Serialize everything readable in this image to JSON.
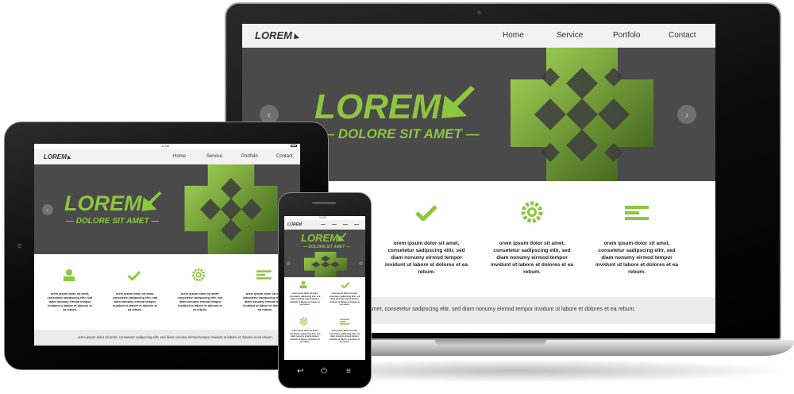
{
  "site": {
    "logo": "LOREM",
    "nav": [
      "Home",
      "Service",
      "Portfolo",
      "Contact"
    ],
    "hero_title": "LOREM",
    "hero_subtitle": "— DOLORE SIT AMET —",
    "feature_text": "orem ipsum dolor sit amet, consetetur sadipscing elitr, sed diam nonumy eirmod tempor invidunt ut labore et dolores et ea rebum.",
    "footer_text": "orem ipsum dolor sit amet, consetetur sadipscing elitr, sed diam nonumy eirmod tempor invidunt ut labore et  dolores et ea rebum.",
    "footer_text_partial": "amet, consetetur sadipscing elitr, sed diam nonumy eirmod tempor invidunt ut labore et  dolores et ea rebum."
  },
  "status": {
    "time": "12:00"
  },
  "icons": [
    "user-icon",
    "check-icon",
    "gear-icon",
    "menu-lines-icon"
  ],
  "colors": {
    "accent": "#8dc63f",
    "hero_bg": "#4a4a4a",
    "nav_bg": "#f2f2f2"
  }
}
